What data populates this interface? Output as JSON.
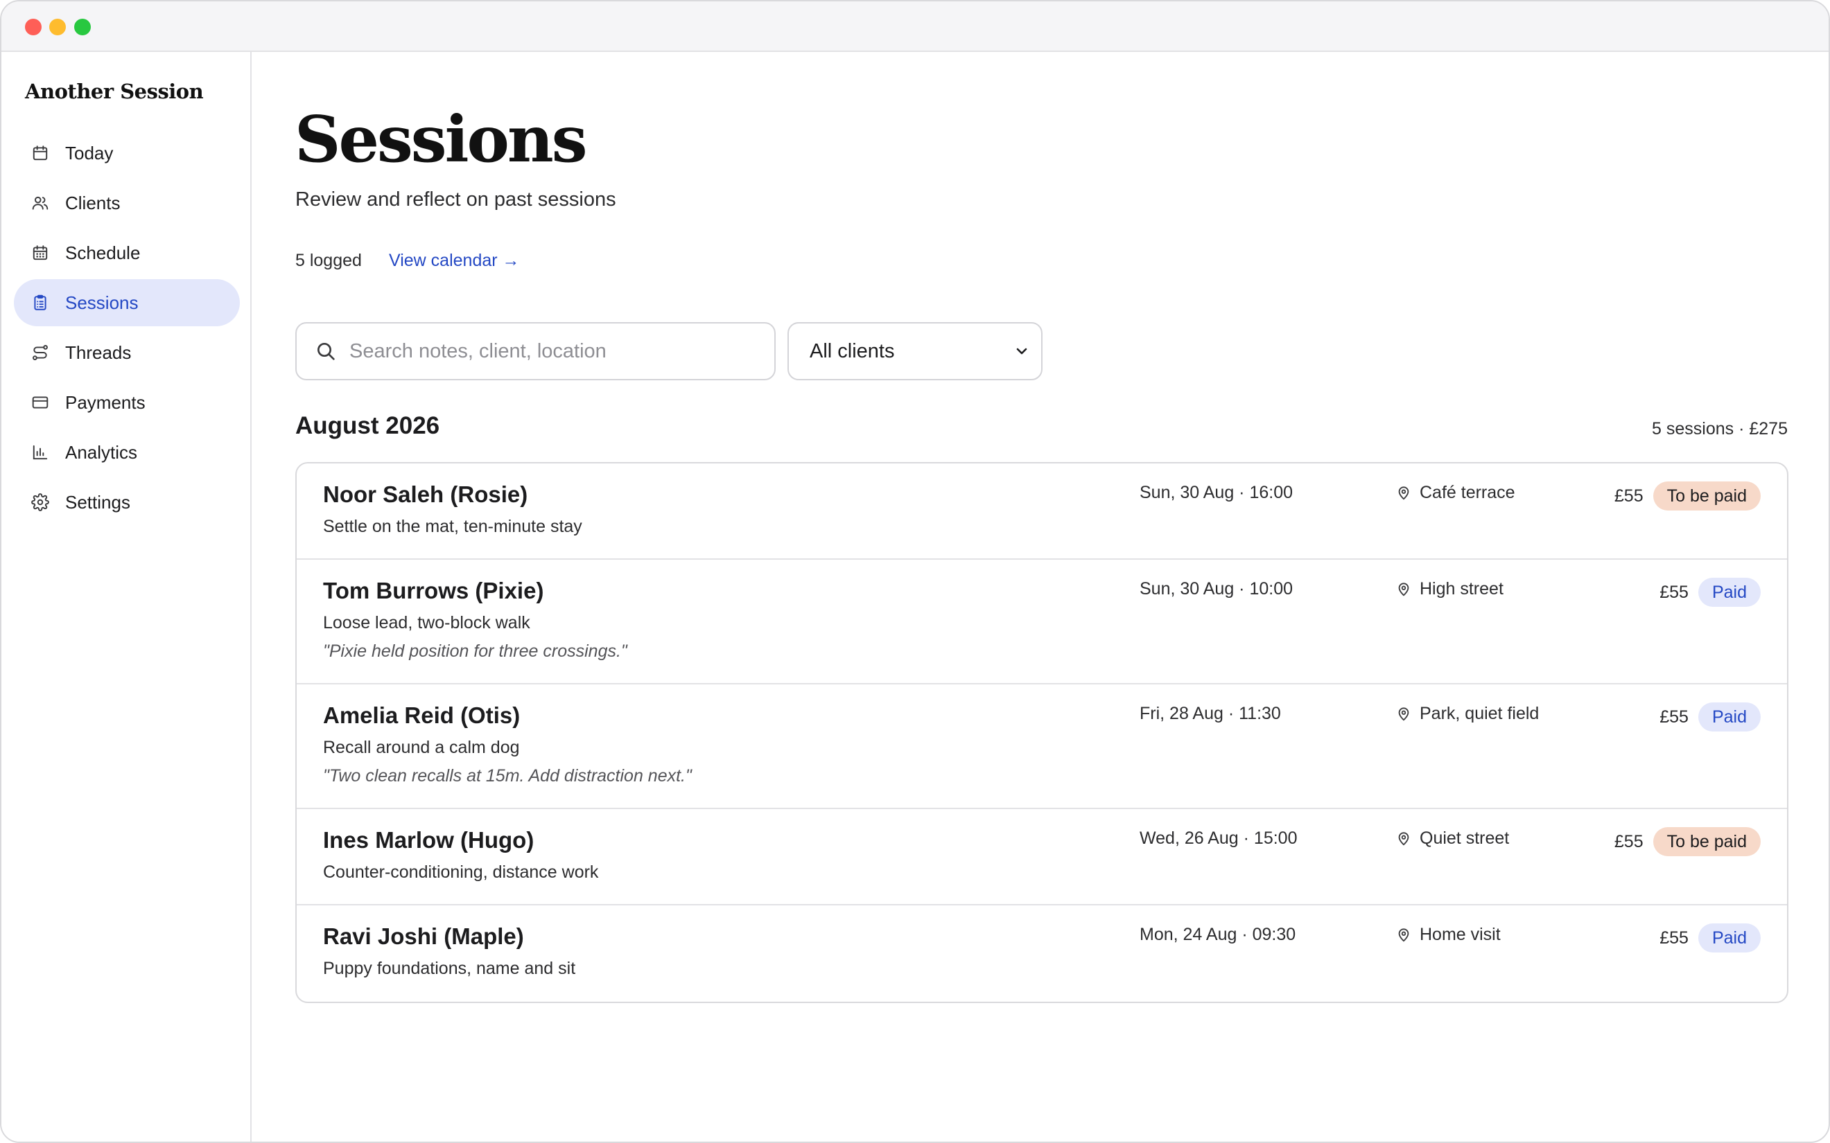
{
  "brand": "Another Session",
  "sidebar": {
    "items": [
      {
        "label": "Today",
        "icon": "calendar-icon"
      },
      {
        "label": "Clients",
        "icon": "users-icon"
      },
      {
        "label": "Schedule",
        "icon": "calendar-grid-icon"
      },
      {
        "label": "Sessions",
        "icon": "clipboard-icon",
        "active": true
      },
      {
        "label": "Threads",
        "icon": "route-icon"
      },
      {
        "label": "Payments",
        "icon": "card-icon"
      },
      {
        "label": "Analytics",
        "icon": "bar-chart-icon"
      },
      {
        "label": "Settings",
        "icon": "gear-icon"
      }
    ]
  },
  "header": {
    "title": "Sessions",
    "subtitle": "Review and reflect on past sessions",
    "count": "5 logged",
    "calendar_link": "View calendar →"
  },
  "filters": {
    "search_placeholder": "Search notes, client, location",
    "client_select": "All clients"
  },
  "group": {
    "title": "August 2026",
    "summary": "5 sessions · £275"
  },
  "sessions": [
    {
      "client": "Noor Saleh (Rosie)",
      "focus": "Settle on the mat, ten-minute stay",
      "note": "",
      "when": "Sun, 30 Aug · 16:00",
      "where": "Café terrace",
      "price": "£55",
      "status": "To be paid",
      "status_type": "due"
    },
    {
      "client": "Tom Burrows (Pixie)",
      "focus": "Loose lead, two-block walk",
      "note": "\"Pixie held position for three crossings.\"",
      "when": "Sun, 30 Aug · 10:00",
      "where": "High street",
      "price": "£55",
      "status": "Paid",
      "status_type": "paid"
    },
    {
      "client": "Amelia Reid (Otis)",
      "focus": "Recall around a calm dog",
      "note": "\"Two clean recalls at 15m. Add distraction next.\"",
      "when": "Fri, 28 Aug · 11:30",
      "where": "Park, quiet field",
      "price": "£55",
      "status": "Paid",
      "status_type": "paid"
    },
    {
      "client": "Ines Marlow (Hugo)",
      "focus": "Counter-conditioning, distance work",
      "note": "",
      "when": "Wed, 26 Aug · 15:00",
      "where": "Quiet street",
      "price": "£55",
      "status": "To be paid",
      "status_type": "due"
    },
    {
      "client": "Ravi Joshi (Maple)",
      "focus": "Puppy foundations, name and sit",
      "note": "",
      "when": "Mon, 24 Aug · 09:30",
      "where": "Home visit",
      "price": "£55",
      "status": "Paid",
      "status_type": "paid"
    }
  ],
  "colors": {
    "accent": "#2448c4",
    "active_nav_bg": "#e3e7fb",
    "paid_badge_bg": "#e3e7fb",
    "due_badge_bg": "#f7d9c9"
  }
}
